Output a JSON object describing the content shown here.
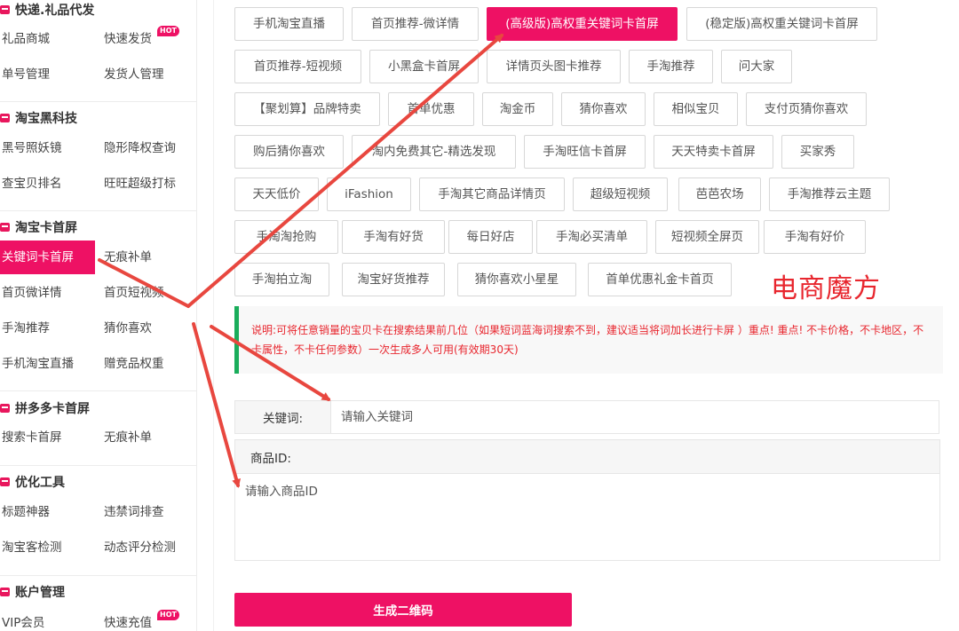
{
  "sidebar": {
    "sections": [
      {
        "title": "快递.礼品代发",
        "items": [
          {
            "label": "礼品商城"
          },
          {
            "label": "快速发货",
            "badge": "HOT"
          },
          {
            "label": "单号管理"
          },
          {
            "label": "发货人管理"
          }
        ]
      },
      {
        "title": "淘宝黑科技",
        "items": [
          {
            "label": "黑号照妖镜"
          },
          {
            "label": "隐形降权查询"
          },
          {
            "label": "查宝贝排名"
          },
          {
            "label": "旺旺超级打标"
          }
        ]
      },
      {
        "title": "淘宝卡首屏",
        "items": [
          {
            "label": "关键词卡首屏",
            "active": true
          },
          {
            "label": "无痕补单"
          },
          {
            "label": "首页微详情"
          },
          {
            "label": "首页短视频"
          },
          {
            "label": "手淘推荐"
          },
          {
            "label": "猜你喜欢"
          },
          {
            "label": "手机淘宝直播"
          },
          {
            "label": "赠竞品权重"
          }
        ]
      },
      {
        "title": "拼多多卡首屏",
        "items": [
          {
            "label": "搜索卡首屏"
          },
          {
            "label": "无痕补单"
          }
        ]
      },
      {
        "title": "优化工具",
        "items": [
          {
            "label": "标题神器"
          },
          {
            "label": "违禁词排查"
          },
          {
            "label": "淘宝客检测"
          },
          {
            "label": "动态评分检测"
          }
        ]
      },
      {
        "title": "账户管理",
        "items": [
          {
            "label": "VIP会员"
          },
          {
            "label": "快速充值",
            "badge": "HOT"
          }
        ]
      }
    ]
  },
  "tags": [
    [
      "手机淘宝直播",
      "首页推荐-微详情",
      "(高级版)高权重关键词卡首屏",
      "(稳定版)高权重关键词卡首屏"
    ],
    [
      "首页推荐-短视频",
      "小黑盒卡首屏",
      "详情页头图卡推荐",
      "手淘推荐",
      "问大家"
    ],
    [
      "【聚划算】品牌特卖",
      "首单优惠",
      "淘金币",
      "猜你喜欢",
      "相似宝贝",
      "支付页猜你喜欢"
    ],
    [
      "购后猜你喜欢",
      "淘内免费其它-精选发现",
      "手淘旺信卡首屏",
      "天天特卖卡首屏",
      "买家秀"
    ],
    [
      "天天低价",
      "iFashion",
      "手淘其它商品详情页",
      "超级短视频",
      "芭芭农场",
      "手淘推荐云主题"
    ],
    [
      "手淘淘抢购",
      "手淘有好货",
      "每日好店",
      "手淘必买清单",
      "短视频全屏页",
      "手淘有好价"
    ],
    [
      "手淘拍立淘",
      "淘宝好货推荐",
      "猜你喜欢小星星",
      "首单优惠礼金卡首页"
    ]
  ],
  "active_tag": "(高级版)高权重关键词卡首屏",
  "watermark": "电商魔方",
  "notice": "说明:可将任意销量的宝贝卡在搜索结果前几位（如果短词蓝海词搜索不到，建议适当将词加长进行卡屏 ）重点! 重点! 不卡价格，不卡地区，不卡属性，不卡任何参数）一次生成多人可用(有效期30天)",
  "form": {
    "keyword_label": "关键词:",
    "keyword_placeholder": "请输入关键词",
    "keyword_value": "",
    "product_label": "商品ID:",
    "product_placeholder": "请输入商品ID",
    "product_value": "",
    "submit_label": "生成二维码"
  },
  "colors": {
    "accent": "#ee1164",
    "notice_bar": "#1aad5b",
    "notice_text": "#e8262e",
    "arrow": "#e8473f"
  }
}
